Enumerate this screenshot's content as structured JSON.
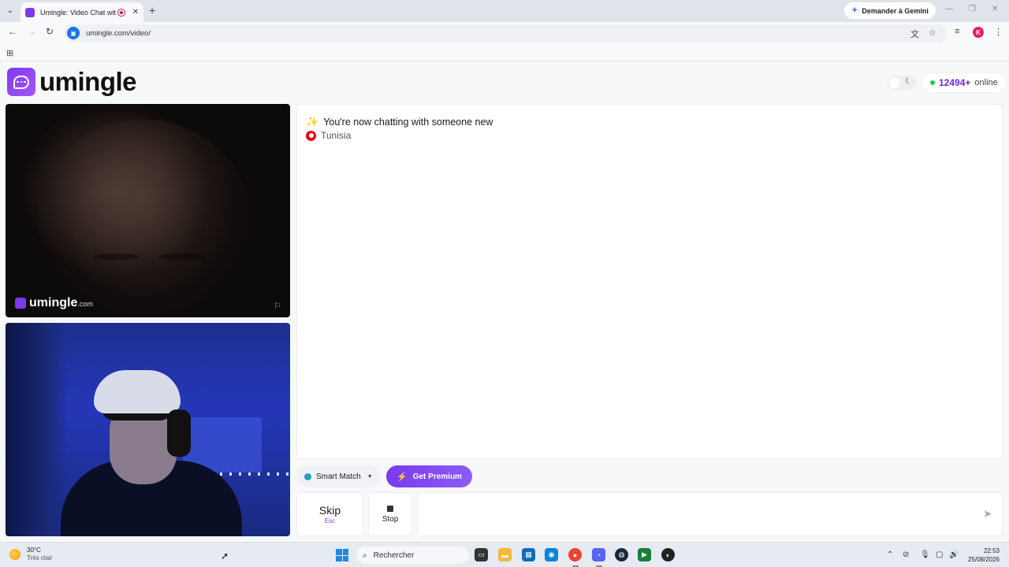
{
  "browser": {
    "tab_title": "Umingle: Video Chat with Str",
    "tab_close": "✕",
    "new_tab": "+",
    "gemini_label": "Demander à Gemini",
    "url": "umingle.com/video/",
    "profile_initial": "K"
  },
  "page": {
    "logo_text": "umingle",
    "online_count": "12494+",
    "online_label": "online",
    "watermark_text": "umingle",
    "watermark_suffix": ".com",
    "chat_status": "You're now chatting with someone new",
    "chat_country": "Tunisia",
    "smart_match_label": "Smart Match",
    "premium_label": "Get Premium",
    "skip_label": "Skip",
    "skip_key": "Esc",
    "stop_label": "Stop",
    "message_placeholder": ""
  },
  "taskbar": {
    "temperature": "30°C",
    "weather_desc": "Très clair",
    "search_placeholder": "Rechercher",
    "time": "22:53",
    "date": "25/08/2026"
  },
  "icons": {
    "tab_menu": "chevron-down-icon",
    "back": "back-arrow-icon",
    "forward": "forward-arrow-icon",
    "reload": "reload-icon",
    "translate": "translate-icon",
    "bookmark": "star-icon",
    "media": "media-control-icon",
    "menu": "kebab-menu-icon",
    "send": "send-icon",
    "report": "flag-icon"
  },
  "colors": {
    "brand": "#7c3aed",
    "online_dot": "#22c55e",
    "online_count": "#6d28d9",
    "country_flag": "#e70013"
  }
}
